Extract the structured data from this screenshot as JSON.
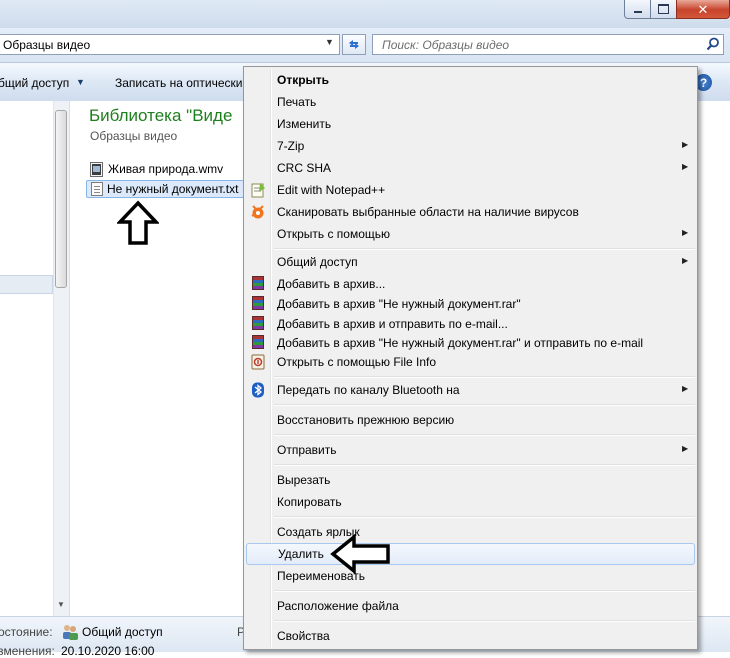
{
  "window": {
    "address": "Образцы видео",
    "search_placeholder": "Поиск: Образцы видео",
    "close_color": "#c7442c"
  },
  "commandbar": {
    "share": "бщий доступ",
    "burn": "Записать на оптически",
    "help": "?"
  },
  "library": {
    "title": "Библиотека \"Виде",
    "subtitle": "Образцы видео",
    "files": [
      {
        "name": "Живая природа.wmv"
      },
      {
        "name": "Не нужный документ.txt"
      }
    ]
  },
  "status": {
    "label": "остояние:",
    "value": "Общий доступ",
    "label2": "зменения:",
    "value2": "20.10.2020 16:00",
    "cut": "Р"
  },
  "context_menu": {
    "items": [
      {
        "label": "Открыть",
        "bold": true
      },
      {
        "label": "Печать"
      },
      {
        "label": "Изменить"
      },
      {
        "label": "7-Zip",
        "submenu": true
      },
      {
        "label": "CRC SHA",
        "submenu": true
      },
      {
        "label": "Edit with Notepad++",
        "icon": "notepadpp-icon"
      },
      {
        "label": "Сканировать выбранные области на наличие вирусов",
        "icon": "avast-icon"
      },
      {
        "label": "Открыть с помощью",
        "submenu": true
      },
      {
        "label": "Общий доступ",
        "submenu": true
      },
      {
        "label": "Добавить в архив...",
        "icon": "winrar-icon"
      },
      {
        "label": "Добавить в архив \"Не нужный документ.rar\"",
        "icon": "winrar-icon"
      },
      {
        "label": "Добавить в архив и отправить по e-mail...",
        "icon": "winrar-icon"
      },
      {
        "label": "Добавить в архив \"Не нужный документ.rar\" и отправить по e-mail",
        "icon": "winrar-icon"
      },
      {
        "label": "Открыть с помощью File Info",
        "icon": "fileinfo-icon"
      },
      {
        "label": "Передать по каналу Bluetooth на",
        "submenu": true,
        "icon": "bluetooth-icon"
      },
      {
        "label": "Восстановить прежнюю версию"
      },
      {
        "label": "Отправить",
        "submenu": true
      },
      {
        "label": "Вырезать"
      },
      {
        "label": "Копировать"
      },
      {
        "label": "Создать ярлык"
      },
      {
        "label": "Удалить",
        "highlighted": true
      },
      {
        "label": "Переименовать"
      },
      {
        "label": "Расположение файла"
      },
      {
        "label": "Свойства"
      }
    ],
    "submenu_glyph": "▶"
  }
}
